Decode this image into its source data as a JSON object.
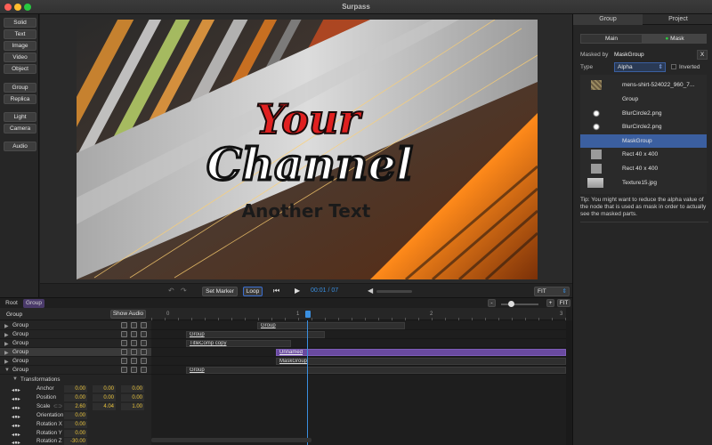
{
  "window": {
    "title": "Surpass"
  },
  "toolbar": {
    "solid": "Solid",
    "text": "Text",
    "image": "Image",
    "video": "Video",
    "object": "Object",
    "group": "Group",
    "replica": "Replica",
    "light": "Light",
    "camera": "Camera",
    "audio": "Audio"
  },
  "preview": {
    "title_line1": "Your",
    "title_line2": "Channel",
    "subtitle": "Another Text"
  },
  "transport": {
    "set_marker": "Set Marker",
    "loop": "Loop",
    "time": "00:01 / 07",
    "zoom": "FIT"
  },
  "panel": {
    "tabs": [
      "Group",
      "Project"
    ],
    "subtabs": [
      "Main",
      "Mask"
    ],
    "masked_by_label": "Masked by",
    "masked_by_value": "MaskGroup",
    "clear": "X",
    "type_label": "Type",
    "type_value": "Alpha",
    "inverted": "Inverted",
    "nodes": [
      {
        "label": "mens-shirt-524022_960_7...",
        "thumb": "pattern"
      },
      {
        "label": "Group",
        "thumb": "none"
      },
      {
        "label": "BlurCircle2.png",
        "thumb": "dot"
      },
      {
        "label": "BlurCircle2.png",
        "thumb": "dot"
      },
      {
        "label": "MaskGroup",
        "thumb": "none",
        "selected": true
      },
      {
        "label": "Rect 40 x 400",
        "thumb": "gray"
      },
      {
        "label": "Rect 40 x 400",
        "thumb": "gray"
      },
      {
        "label": "Texture15.jpg",
        "thumb": "texture"
      }
    ],
    "tip": "Tip: You might want to reduce the alpha value of the node that is used as mask in order to actually see the masked parts."
  },
  "timeline": {
    "breadcrumbs": [
      "Root",
      "Group"
    ],
    "header_title": "Group",
    "show_audio": "Show Audio",
    "zoom_minus": "-",
    "zoom_plus": "+",
    "zoom_fit": "FIT",
    "ruler": [
      "0",
      "1",
      "2",
      "3"
    ],
    "layers": [
      "Group",
      "Group",
      "Group",
      "Group",
      "Group",
      "Group"
    ],
    "transform_title": "Transformations",
    "transforms": [
      {
        "name": "Anchor",
        "values": [
          "0.00",
          "0.00",
          "0.00"
        ]
      },
      {
        "name": "Position",
        "values": [
          "0.00",
          "0.00",
          "0.00"
        ]
      },
      {
        "name": "Scale",
        "values": [
          "2.60",
          "4.04",
          "1.00"
        ]
      },
      {
        "name": "Orientation",
        "values": [
          "0.00",
          "",
          ""
        ]
      },
      {
        "name": "Rotation X",
        "values": [
          "0.00",
          "",
          ""
        ]
      },
      {
        "name": "Rotation Y",
        "values": [
          "0.00",
          "",
          ""
        ]
      },
      {
        "name": "Rotation Z",
        "values": [
          "-30.00",
          "",
          ""
        ]
      }
    ],
    "clips": [
      "Group",
      "Group",
      "TitleComp copy",
      "Unnamed",
      "MaskGroup",
      "Group"
    ]
  },
  "colors": {
    "accent": "#3b5fa0",
    "clip_purple": "#6a4aa0",
    "value_yellow": "#e8c23a",
    "playhead": "#3a8fe0"
  }
}
